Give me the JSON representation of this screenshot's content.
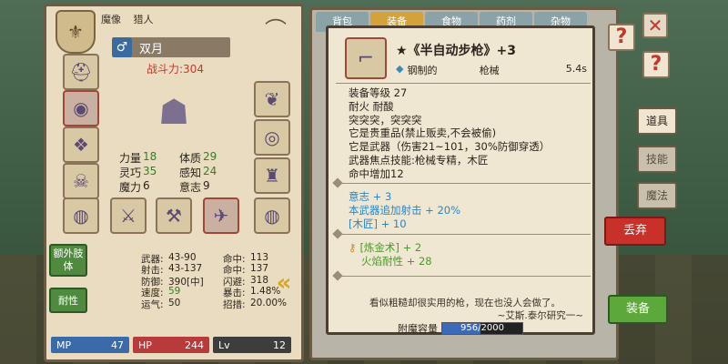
{
  "character": {
    "titles": [
      "魔像",
      "猎人"
    ],
    "gender_symbol": "♂",
    "name": "双月",
    "power": "战斗力:304",
    "primary_stats": [
      {
        "k": "力量",
        "v": "18",
        "k2": "体质",
        "v2": "29"
      },
      {
        "k": "灵巧",
        "v": "35",
        "k2": "感知",
        "v2": "24"
      },
      {
        "k": "魔力",
        "v": "6",
        "k2": "意志",
        "v2": "9"
      }
    ],
    "secondary_stats": [
      {
        "k": "武器:",
        "v": "43-90",
        "k2": "命中:",
        "v2": "113"
      },
      {
        "k": "射击:",
        "v": "43-137",
        "k2": "命中:",
        "v2": "137"
      },
      {
        "k": "防御:",
        "v": "390[中]",
        "k2": "闪避:",
        "v2": "318"
      },
      {
        "k": "速度:",
        "v": "59",
        "k2": "暴击:",
        "v2": "1.48%"
      },
      {
        "k": "运气:",
        "v": "50",
        "k2": "招措:",
        "v2": "20.00%"
      }
    ],
    "side_buttons": {
      "extra_limbs": "额外肢体",
      "resistance": "耐性"
    },
    "bars": {
      "mp_label": "MP",
      "mp": "47",
      "hp_label": "HP",
      "hp": "244",
      "lv_label": "Lv",
      "lv": "12"
    }
  },
  "inventory": {
    "tabs": [
      "背包",
      "装备",
      "食物",
      "药剂",
      "杂物"
    ],
    "active_tab": 1,
    "right_menu": [
      "道具",
      "技能",
      "魔法"
    ],
    "discard_label": "丢弃",
    "equip_label": "装备"
  },
  "item": {
    "title": "★《半自动步枪》+3",
    "material": "钢制的",
    "category": "枪械",
    "speed": "5.4s",
    "lines": [
      "装备等级 27",
      "耐火 耐酸",
      "突突突，突突突",
      "它是贵重品(禁止贩卖,不会被偷)",
      "它是武器（伤害21~101，30%防御穿透）",
      "武器焦点技能:枪械专精，木匠",
      "命中增加12"
    ],
    "bonus_lines": [
      "意志 + 3",
      "本武器追加射击 + 20%",
      "[木匠] + 10"
    ],
    "alchemy_lines": [
      "[炼金术] + 2",
      "火焰耐性 + 28"
    ],
    "flavor": "看似粗糙却很实用的枪，现在也没人会做了。",
    "author": "~艾斯.泰尔研究一~",
    "capacity_label": "附魔容量",
    "capacity_value": "956/2000",
    "capacity_fraction": 0.478
  }
}
